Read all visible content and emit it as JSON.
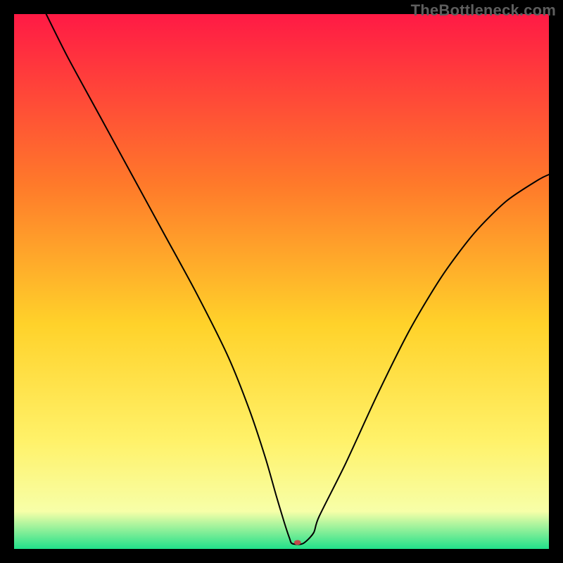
{
  "watermark": "TheBottleneck.com",
  "chart_data": {
    "type": "line",
    "title": "",
    "xlabel": "",
    "ylabel": "",
    "xlim": [
      0,
      100
    ],
    "ylim": [
      0,
      100
    ],
    "background_gradient": {
      "top": "#ff1a45",
      "mid_upper": "#ff7a2a",
      "mid": "#ffd22a",
      "mid_lower": "#fff26a",
      "near_bottom": "#f7ffa8",
      "bottom": "#21e08a"
    },
    "series": [
      {
        "name": "bottleneck-curve",
        "x": [
          6,
          10,
          16,
          22,
          28,
          34,
          40,
          44,
          47,
          49,
          50.5,
          51.5,
          52,
          54,
          56,
          57,
          62,
          68,
          74,
          80,
          86,
          92,
          98,
          100
        ],
        "y": [
          100,
          92,
          81,
          70,
          59,
          48,
          36,
          26,
          17,
          10,
          5,
          2,
          1,
          1,
          3,
          6,
          16,
          29,
          41,
          51,
          59,
          65,
          69,
          70
        ],
        "stroke": "#000000",
        "stroke_width": 2
      }
    ],
    "marker": {
      "name": "optimal-point",
      "x": 53,
      "y": 1.2,
      "rx": 5,
      "ry": 3.5,
      "fill": "#c24a4a"
    }
  }
}
